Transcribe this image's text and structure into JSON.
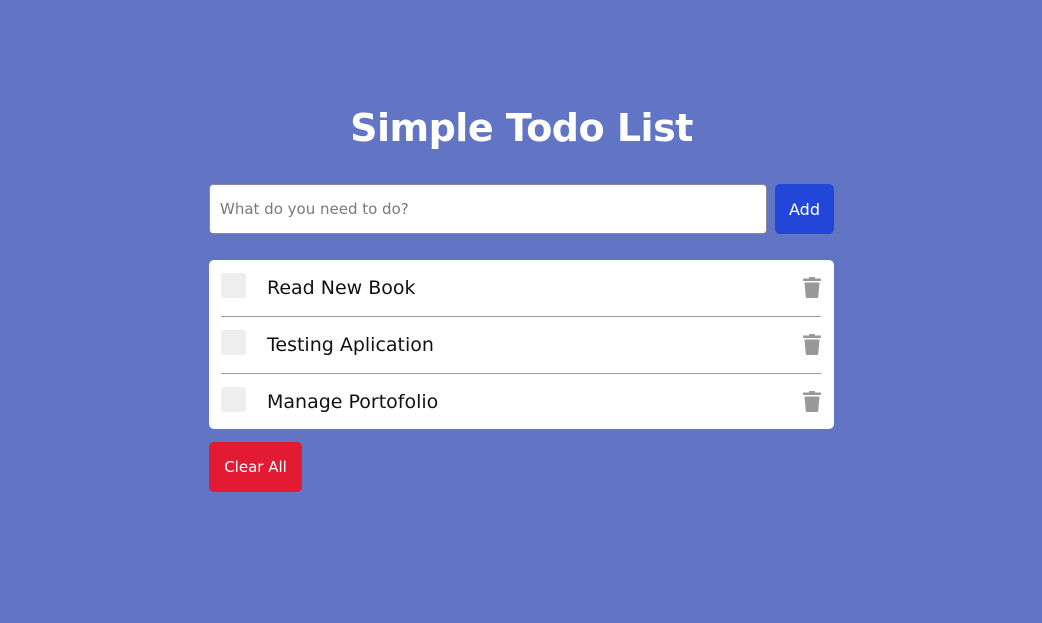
{
  "page": {
    "title": "Simple Todo List"
  },
  "form": {
    "input_value": "",
    "input_placeholder": "What do you need to do?",
    "add_label": "Add"
  },
  "todos": [
    {
      "text": "Read New Book",
      "done": false
    },
    {
      "text": "Testing Aplication",
      "done": false
    },
    {
      "text": "Manage Portofolio",
      "done": false
    }
  ],
  "actions": {
    "clear_label": "Clear All"
  },
  "icons": {
    "delete": "trash-icon"
  },
  "colors": {
    "background": "#6275c5",
    "add_button": "#2146d8",
    "clear_button": "#e21a34",
    "checkbox": "#eeeeee",
    "trash": "#999999"
  }
}
